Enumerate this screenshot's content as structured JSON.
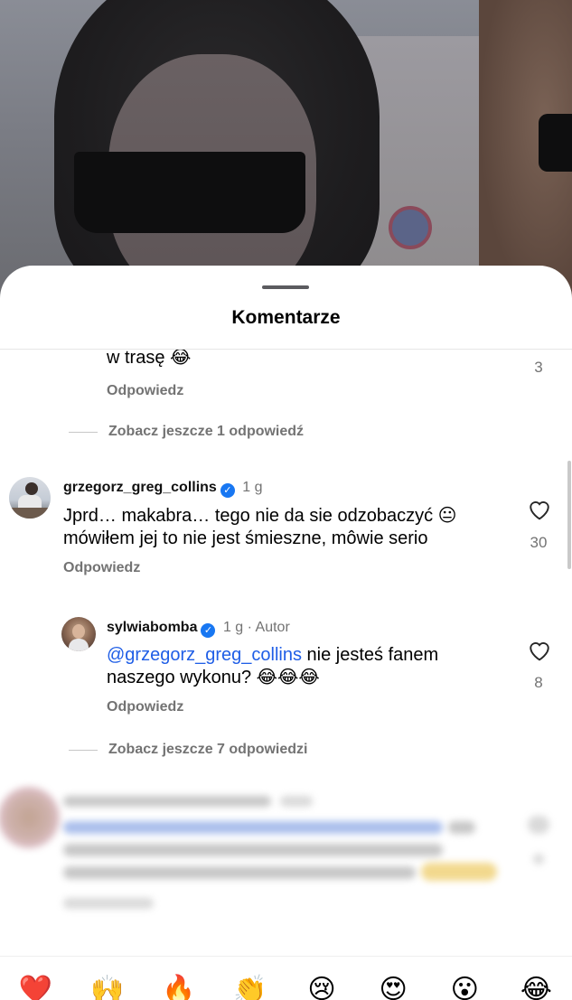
{
  "sheet": {
    "title": "Komentarze"
  },
  "comments": {
    "partial_reply": {
      "text": "w trasę 😂",
      "likes": "3",
      "reply_label": "Odpowiedz",
      "view_more": "Zobacz jeszcze 1 odpowiedź"
    },
    "main": {
      "username": "grzegorz_greg_collins",
      "time": "1 g",
      "text_line1": "Jprd… makabra… tego nie da sie odzobaczyć 😐",
      "text_line2": "mówiłem jej to nie jest śmieszne, môwie serio",
      "likes": "30",
      "reply_label": "Odpowiedz"
    },
    "reply": {
      "username": "sylwiabomba",
      "time": "1 g",
      "author_label": "Autor",
      "mention": "@grzegorz_greg_collins",
      "text_rest": " nie jesteś fanem",
      "text_line2": "naszego wykonu? 😂😂😂",
      "likes": "8",
      "reply_label": "Odpowiedz",
      "view_more": "Zobacz jeszcze 7 odpowiedzi"
    }
  },
  "emoji_bar": [
    "❤️",
    "🙌",
    "🔥",
    "👏",
    "😢",
    "😍",
    "😮",
    "😂"
  ],
  "colors": {
    "mention": "#1f5ee6",
    "verified": "#1877f2",
    "muted": "#737373"
  }
}
